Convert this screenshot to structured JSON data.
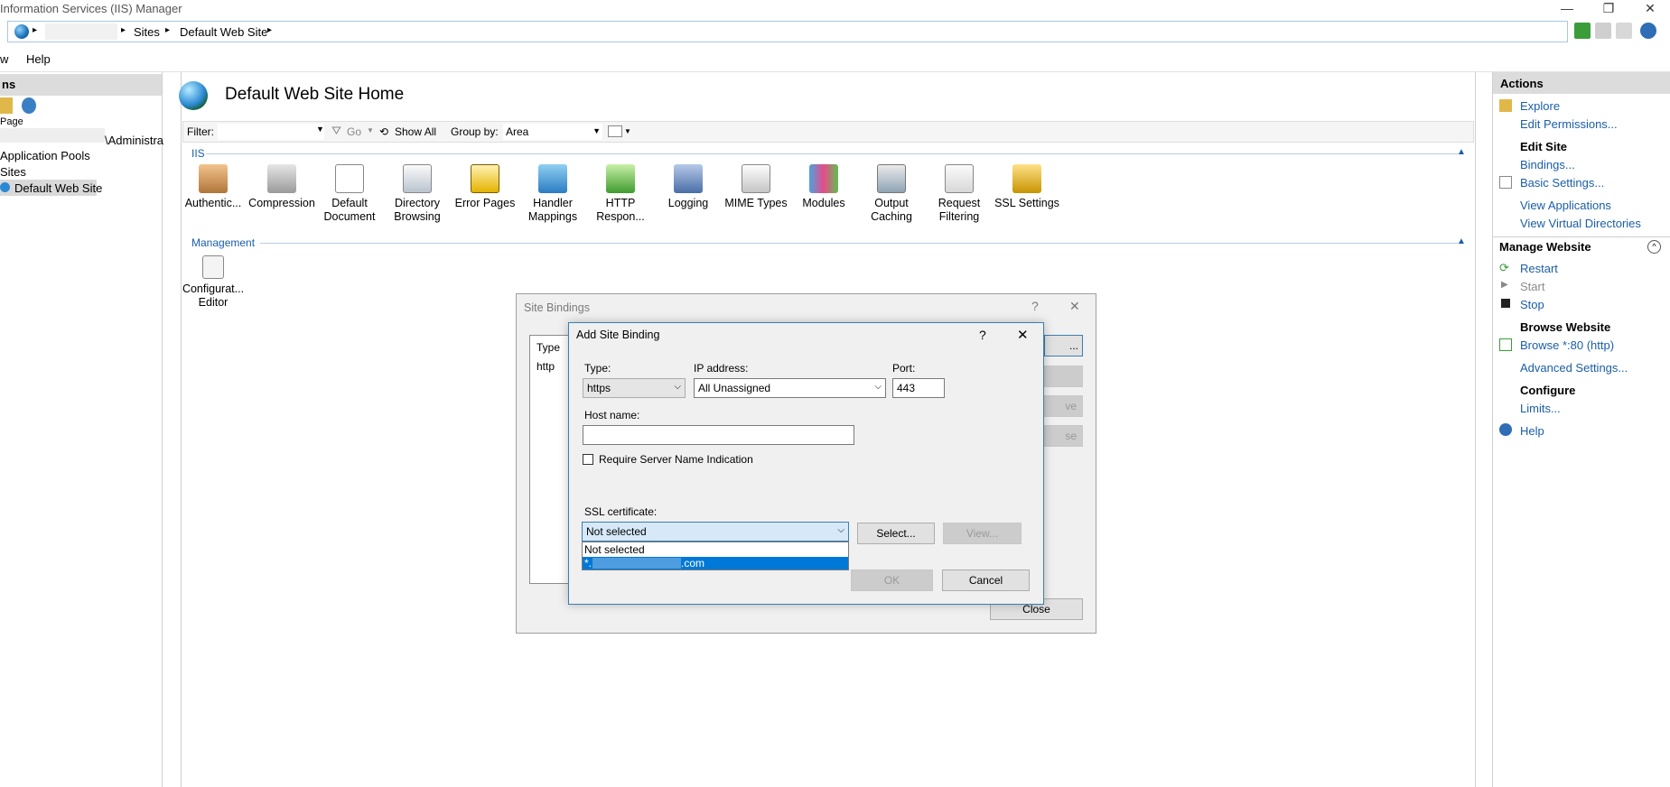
{
  "window": {
    "title": "Information Services (IIS) Manager",
    "controls": {
      "minimize": "—",
      "restore": "❐",
      "close": "✕"
    }
  },
  "address": {
    "segments": [
      "Sites",
      "Default Web Site"
    ],
    "separator": "▸"
  },
  "menu": {
    "items": [
      "w",
      "Help"
    ]
  },
  "left": {
    "header": "ns",
    "tree": [
      {
        "label": "Page",
        "selected": false
      },
      {
        "label": "\\Administra",
        "selected": false
      },
      {
        "label": "Application Pools",
        "selected": false
      },
      {
        "label": "Sites",
        "selected": false
      },
      {
        "label": "Default Web Site",
        "selected": true
      }
    ]
  },
  "center": {
    "title": "Default Web Site Home",
    "filter": {
      "label": "Filter:",
      "go": "Go",
      "show_all": "Show All",
      "group_by_label": "Group by:",
      "group_by_value": "Area"
    },
    "sections": [
      {
        "name": "IIS",
        "features": [
          {
            "label": "Authentic...",
            "icon": "authentication-icon"
          },
          {
            "label": "Compression",
            "icon": "compression-icon"
          },
          {
            "label": "Default Document",
            "icon": "default-document-icon"
          },
          {
            "label": "Directory Browsing",
            "icon": "directory-browsing-icon"
          },
          {
            "label": "Error Pages",
            "icon": "error-pages-icon"
          },
          {
            "label": "Handler Mappings",
            "icon": "handler-mappings-icon"
          },
          {
            "label": "HTTP Respon...",
            "icon": "http-response-icon"
          },
          {
            "label": "Logging",
            "icon": "logging-icon"
          },
          {
            "label": "MIME Types",
            "icon": "mime-types-icon"
          },
          {
            "label": "Modules",
            "icon": "modules-icon"
          },
          {
            "label": "Output Caching",
            "icon": "output-caching-icon"
          },
          {
            "label": "Request Filtering",
            "icon": "request-filtering-icon"
          },
          {
            "label": "SSL Settings",
            "icon": "ssl-settings-icon"
          }
        ]
      },
      {
        "name": "Management",
        "features": [
          {
            "label": "Configurat... Editor",
            "icon": "configuration-editor-icon"
          }
        ]
      }
    ]
  },
  "actions": {
    "header": "Actions",
    "explore": "Explore",
    "edit_permissions": "Edit Permissions...",
    "edit_site": "Edit Site",
    "bindings": "Bindings...",
    "basic_settings": "Basic Settings...",
    "view_applications": "View Applications",
    "view_virtual_directories": "View Virtual Directories",
    "manage_website": "Manage Website",
    "restart": "Restart",
    "start": "Start",
    "stop": "Stop",
    "browse_website": "Browse Website",
    "browse_80": "Browse *:80 (http)",
    "advanced_settings": "Advanced Settings...",
    "configure": "Configure",
    "limits": "Limits...",
    "help": "Help"
  },
  "site_bindings": {
    "title": "Site Bindings",
    "col_type": "Type",
    "row_type": "http",
    "close": "Close",
    "side_buttons": [
      "...",
      "",
      "ve",
      "se"
    ]
  },
  "add_binding": {
    "title": "Add Site Binding",
    "type_label": "Type:",
    "type_value": "https",
    "ip_label": "IP address:",
    "ip_value": "All Unassigned",
    "port_label": "Port:",
    "port_value": "443",
    "host_label": "Host name:",
    "host_value": "",
    "sni_label": "Require Server Name Indication",
    "ssl_label": "SSL certificate:",
    "ssl_value": "Not selected",
    "ssl_options": [
      "Not selected",
      "*.",
      ".com"
    ],
    "select_btn": "Select...",
    "view_btn": "View...",
    "ok_btn": "OK",
    "cancel_btn": "Cancel",
    "help_glyph": "?",
    "close_glyph": "✕"
  },
  "colors": {
    "link": "#1a5ea8",
    "selection": "#0078d7",
    "dialog_border": "#3c7fb1"
  }
}
